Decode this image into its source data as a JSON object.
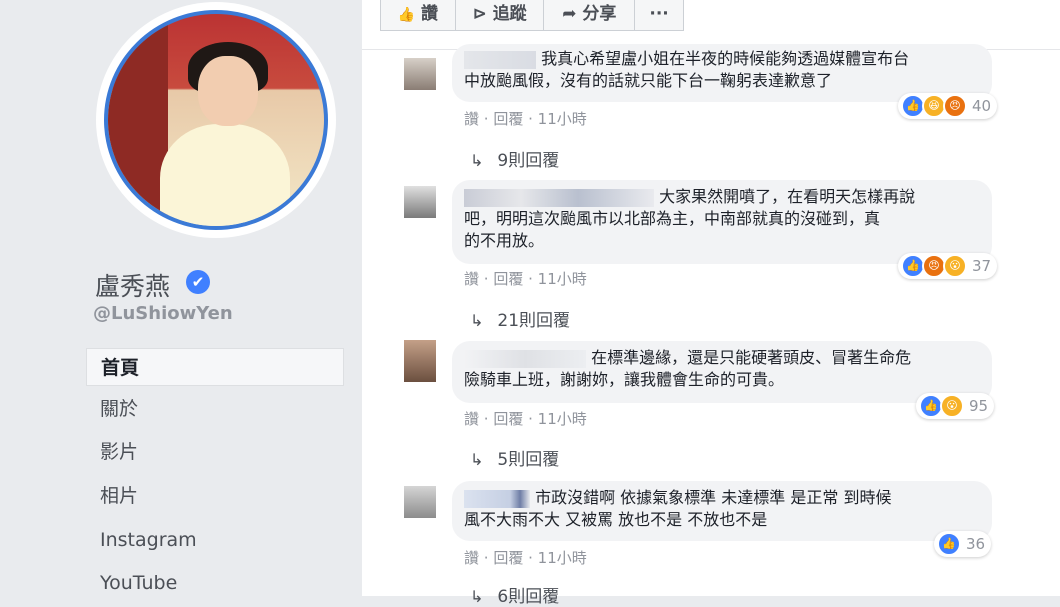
{
  "profile": {
    "name": "盧秀燕",
    "handle": "@LuShiowYen",
    "verified_icon": "✔"
  },
  "nav": [
    "首頁",
    "關於",
    "影片",
    "相片",
    "Instagram",
    "YouTube"
  ],
  "actions": [
    {
      "icon": "thumbs-up-icon",
      "glyph": "👍",
      "label": "讚"
    },
    {
      "icon": "rss-icon",
      "glyph": "⊳",
      "label": "追蹤"
    },
    {
      "icon": "share-icon",
      "glyph": "➦",
      "label": "分享"
    },
    {
      "icon": "more-icon",
      "glyph": "",
      "label": "···"
    }
  ],
  "comments": [
    {
      "line1": "我真心希望盧小姐在半夜的時候能夠透過媒體宣布台",
      "line2": "中放颱風假，沒有的話就只能下台一鞠躬表達歉意了",
      "line3": "",
      "like": "讚",
      "reply": "回覆",
      "time": "11小時",
      "reactions": "40",
      "replies": "9則回覆"
    },
    {
      "line1": "大家果然開噴了，在看明天怎樣再說",
      "line2": "吧，明明這次颱風市以北部為主，中南部就真的沒碰到，真",
      "line3": "的不用放。",
      "like": "讚",
      "reply": "回覆",
      "time": "11小時",
      "reactions": "37",
      "replies": "21則回覆"
    },
    {
      "line1": "在標準邊緣，還是只能硬著頭皮、冒著生命危",
      "line2": "險騎車上班，謝謝妳，讓我體會生命的可貴。",
      "line3": "",
      "like": "讚",
      "reply": "回覆",
      "time": "11小時",
      "reactions": "95",
      "replies": "5則回覆"
    },
    {
      "line1": "市政沒錯啊 依據氣象標準 未達標準 是正常 到時候",
      "line2": "風不大雨不大 又被罵 放也不是 不放也不是",
      "line3": "",
      "like": "讚",
      "reply": "回覆",
      "time": "11小時",
      "reactions": "36",
      "replies": "6則回覆"
    }
  ],
  "colors": {
    "accent": "#4080ff",
    "like": "#4080ff",
    "haha": "#f7b125",
    "angry": "#e9710f",
    "wow": "#f7b125"
  }
}
